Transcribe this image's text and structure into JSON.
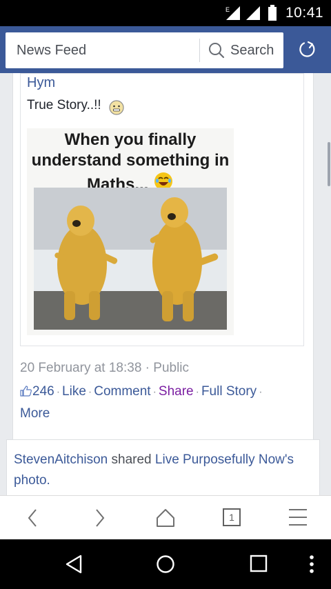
{
  "status_bar": {
    "network_badge": "E",
    "time": "10:41"
  },
  "header": {
    "title": "News Feed",
    "search_label": "Search"
  },
  "post": {
    "author": "Hym",
    "text": "True Story..!!",
    "image_caption": "When you finally understand something in Maths...",
    "timestamp": "20 February at 18:38 · Public",
    "likes_count": "246",
    "actions": {
      "like": "Like",
      "comment": "Comment",
      "share": "Share",
      "full_story": "Full Story",
      "more": "More"
    },
    "separator": "·"
  },
  "next_post": {
    "author": "StevenAitchison",
    "verb": "shared",
    "page": "Live Purposefully Now's",
    "object": "photo."
  },
  "browser": {
    "tab_count": "1"
  },
  "colors": {
    "brand": "#3b5998",
    "link": "#3b5998",
    "visited": "#7b1fa2",
    "meta": "#90949c"
  },
  "icons": [
    "signal-icon",
    "battery-icon",
    "search-icon",
    "refresh-icon",
    "smiley-icon",
    "laughing-emoji-icon",
    "like-icon",
    "back-icon",
    "forward-icon",
    "home-icon",
    "tabs-icon",
    "menu-icon",
    "nav-back-icon",
    "nav-home-icon",
    "nav-recents-icon",
    "overflow-icon"
  ]
}
